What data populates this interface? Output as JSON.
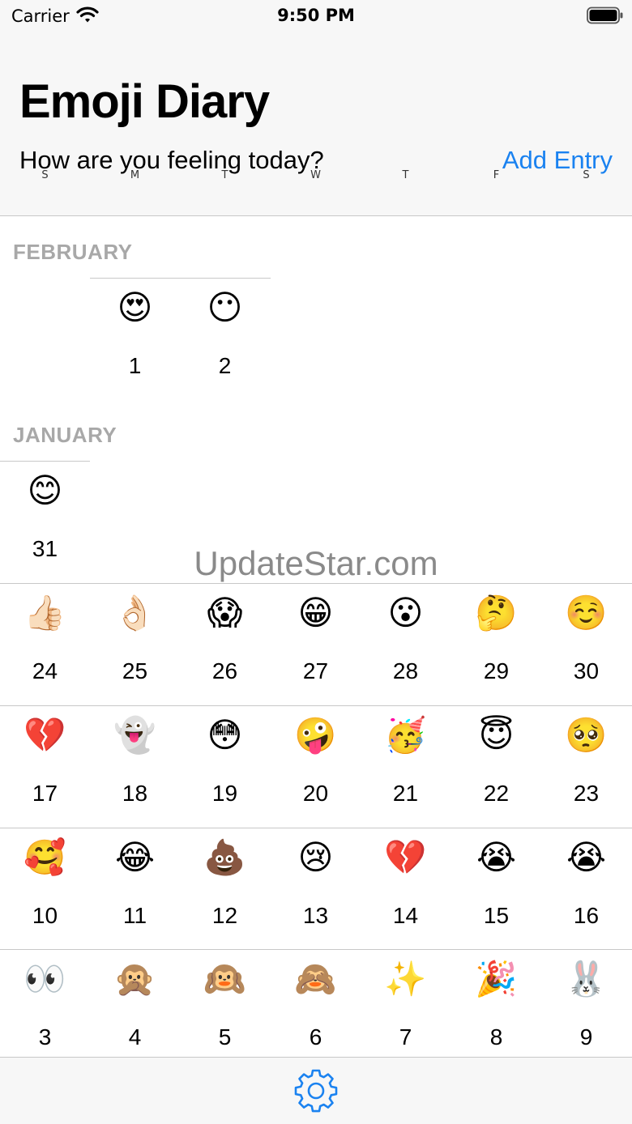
{
  "status_bar": {
    "carrier": "Carrier",
    "time": "9:50 PM"
  },
  "header": {
    "title": "Emoji Diary",
    "subtitle": "How are you feeling today?",
    "add_entry_label": "Add Entry",
    "weekdays": [
      "S",
      "M",
      "T",
      "W",
      "T",
      "F",
      "S"
    ]
  },
  "months": [
    {
      "label": "FEBRUARY",
      "entries": [
        {
          "day": "1",
          "emoji": "😍"
        },
        {
          "day": "2",
          "emoji": "😶"
        }
      ]
    },
    {
      "label": "JANUARY",
      "entries": [
        {
          "day": "31",
          "emoji": "😊"
        },
        {
          "day": "24",
          "emoji": "👍🏻"
        },
        {
          "day": "25",
          "emoji": "👌🏻"
        },
        {
          "day": "26",
          "emoji": "😱"
        },
        {
          "day": "27",
          "emoji": "😁"
        },
        {
          "day": "28",
          "emoji": "😮"
        },
        {
          "day": "29",
          "emoji": "🤔"
        },
        {
          "day": "30",
          "emoji": "☺️"
        },
        {
          "day": "17",
          "emoji": "💔"
        },
        {
          "day": "18",
          "emoji": "👻"
        },
        {
          "day": "19",
          "emoji": "😳"
        },
        {
          "day": "20",
          "emoji": "🤪"
        },
        {
          "day": "21",
          "emoji": "🥳"
        },
        {
          "day": "22",
          "emoji": "😇"
        },
        {
          "day": "23",
          "emoji": "🥺"
        },
        {
          "day": "10",
          "emoji": "🥰"
        },
        {
          "day": "11",
          "emoji": "😂"
        },
        {
          "day": "12",
          "emoji": "💩"
        },
        {
          "day": "13",
          "emoji": "😢"
        },
        {
          "day": "14",
          "emoji": "💔"
        },
        {
          "day": "15",
          "emoji": "😭"
        },
        {
          "day": "16",
          "emoji": "😭"
        },
        {
          "day": "3",
          "emoji": "👀"
        },
        {
          "day": "4",
          "emoji": "🙊"
        },
        {
          "day": "5",
          "emoji": "🙉"
        },
        {
          "day": "6",
          "emoji": "🙈"
        },
        {
          "day": "7",
          "emoji": "✨"
        },
        {
          "day": "8",
          "emoji": "🎉"
        },
        {
          "day": "9",
          "emoji": "🐰"
        }
      ]
    }
  ],
  "watermark": "UpdateStar.com",
  "tab_bar": {
    "settings_icon": "gear-icon",
    "accent": "#1a82f0"
  }
}
